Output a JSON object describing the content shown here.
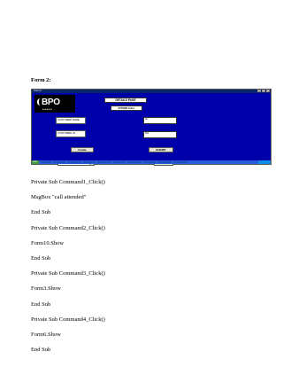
{
  "heading": "Form 2:",
  "form": {
    "title_bar": "Form2",
    "logo_text": "BPO",
    "logo_sub": "■ ■ ■ ■ ■",
    "page_label": "DETAILS PAGE",
    "attend_label": "ATTEND CALL",
    "customer_name_label": "CUSTOMER NAME",
    "customer_id_label": "CUSTOMER I.D.",
    "name_value": "ab",
    "id_value": "001",
    "create_button": "Create",
    "submit_button": "SUBMIT",
    "combo_value": "A 4.4",
    "exit_button": "exit",
    "taskbar": {
      "start": "start",
      "items": [
        "",
        "",
        "",
        "",
        "",
        "",
        "",
        "",
        "",
        ""
      ],
      "clock": ""
    }
  },
  "code_lines": [
    "Private Sub Command1_Click()",
    "MsgBox \"call attended\"",
    "End Sub",
    "Private Sub Command2_Click()",
    "Form10.Show",
    "End Sub",
    "Private Sub Command3_Click()",
    "Form3.Show",
    "End Sub",
    "Private Sub Command4_Click()",
    "Form6.Show",
    "End Sub"
  ]
}
